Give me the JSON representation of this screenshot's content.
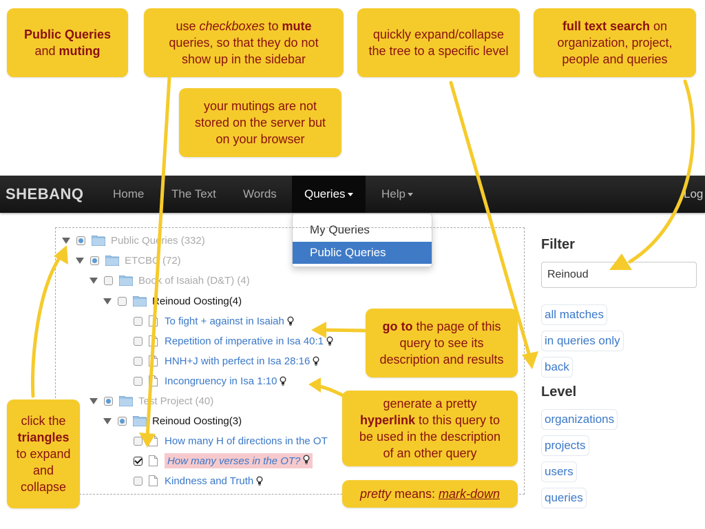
{
  "callouts": {
    "public_queries": {
      "l1": "Public Queries",
      "l2a": "and ",
      "l2b": "muting"
    },
    "checkboxes": {
      "l1a": "use ",
      "l1b": "checkboxes",
      "l1c": " to ",
      "l1d": "mute",
      "l2": "queries, so that they do not",
      "l3": "show up in the sidebar"
    },
    "mutings": {
      "l1": "your mutings are not",
      "l2": "stored on the server but",
      "l3": "on your browser"
    },
    "expand": {
      "l1": "quickly expand/collapse",
      "l2": "the tree to a specific level"
    },
    "search": {
      "l1a": "full text search",
      "l1b": " on",
      "l2": "organization, project,",
      "l3": "people and queries"
    },
    "goto": {
      "l1a": "go to",
      "l1b": " the page of this",
      "l2": "query to see its",
      "l3": "description and results"
    },
    "hyperlink": {
      "l1": "generate a pretty",
      "l2a": "hyperlink",
      "l2b": " to this query to",
      "l3": "be used in the description",
      "l4": "of an other query"
    },
    "pretty": {
      "a": "pretty",
      "b": " means: ",
      "c": "mark-down"
    },
    "triangles": {
      "l1": "click the",
      "l2": "triangles",
      "l3": "to expand",
      "l4": "and",
      "l5": "collapse"
    }
  },
  "navbar": {
    "brand": "SHEBANQ",
    "items": [
      "Home",
      "The Text",
      "Words",
      "Queries",
      "Help"
    ],
    "right": "Log"
  },
  "dropdown": {
    "items": [
      "My Queries",
      "Public Queries"
    ]
  },
  "tree": {
    "root": "Public Queries (332)",
    "org": "ETCBC (72)",
    "proj1": "Book of Isaiah (D&T) (4)",
    "user1": "Reinoud Oosting(4)",
    "q1": "To fight + against in Isaiah",
    "q2": "Repetition of imperative in Isa 40:1",
    "q3": "HNH+J with perfect in Isa 28:16",
    "q4": "Incongruency in Isa 1:10",
    "proj2": "Test Project (40)",
    "user2": "Reinoud Oosting(3)",
    "q5": "How many H of directions in the OT",
    "q6": "How many verses in the OT?",
    "q7": "Kindness and Truth"
  },
  "filter": {
    "title": "Filter",
    "value": "Reinoud",
    "buttons": [
      "all matches",
      "in queries only",
      "back"
    ]
  },
  "level": {
    "title": "Level",
    "buttons": [
      "organizations",
      "projects",
      "users",
      "queries"
    ]
  },
  "colors": {
    "callout": "#f5cb2c",
    "callout_text": "#8b1010",
    "link": "#3a78c9",
    "navbar": "#1b1b1b"
  }
}
